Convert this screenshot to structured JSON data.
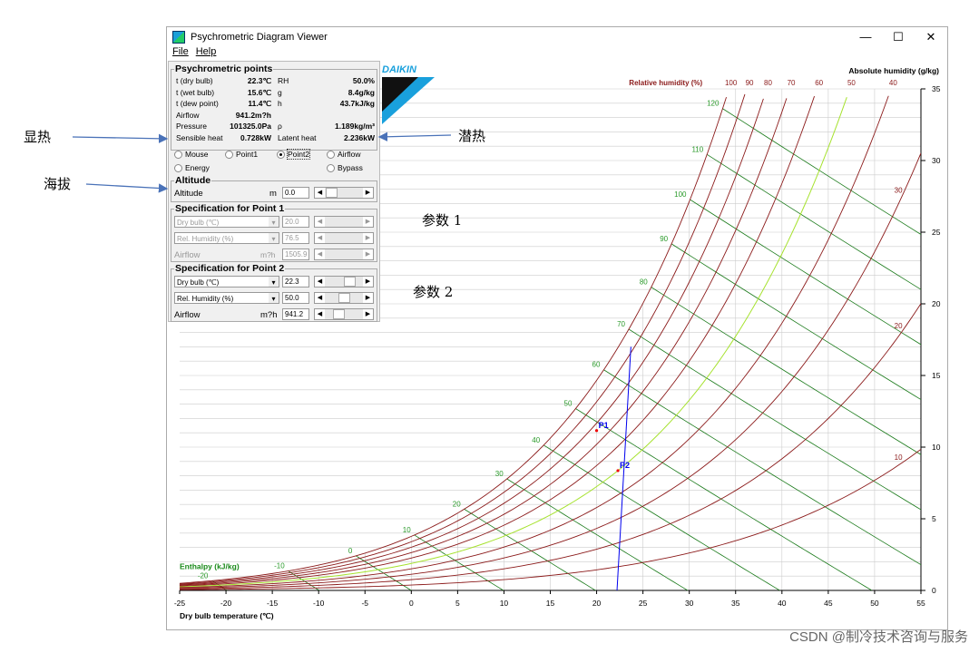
{
  "window": {
    "title": "Psychrometric Diagram Viewer",
    "menu": [
      "File",
      "Help"
    ],
    "controls": [
      "—",
      "☐",
      "✕"
    ]
  },
  "panel": {
    "points_title": "Psychrometric points",
    "rows": [
      {
        "label": "t (dry bulb)",
        "value": "22.3℃",
        "label2": "RH",
        "value2": "50.0%"
      },
      {
        "label": "t (wet bulb)",
        "value": "15.6℃",
        "label2": "g",
        "value2": "8.4g/kg"
      },
      {
        "label": "t (dew point)",
        "value": "11.4℃",
        "label2": "h",
        "value2": "43.7kJ/kg"
      },
      {
        "label": "Airflow",
        "value": "941.2m?h",
        "label2": "",
        "value2": ""
      },
      {
        "label": "Pressure",
        "value": "101325.0Pa",
        "label2": "ρ",
        "value2": "1.189kg/m³"
      },
      {
        "label": "Sensible heat",
        "value": "0.728kW",
        "label2": "Latent heat",
        "value2": "2.236kW"
      }
    ],
    "radios": [
      "Mouse",
      "Point1",
      "Point2",
      "Airflow",
      "Energy",
      "Bypass"
    ],
    "radio_selected": "Point2",
    "altitude": {
      "title": "Altitude",
      "label": "Altitude",
      "unit": "m",
      "value": "0.0"
    },
    "point1": {
      "title": "Specification for Point 1",
      "param1": "Dry bulb (℃)",
      "value1": "20.0",
      "param2": "Rel. Humidity (%)",
      "value2": "76.5",
      "airflow_label": "Airflow",
      "airflow_unit": "m?h",
      "airflow": "1505.9"
    },
    "point2": {
      "title": "Specification for Point 2",
      "param1": "Dry bulb (℃)",
      "value1": "22.3",
      "param2": "Rel. Humidity (%)",
      "value2": "50.0",
      "airflow_label": "Airflow",
      "airflow_unit": "m?h",
      "airflow": "941.2"
    }
  },
  "logo": "DAIKIN",
  "annotations": {
    "sensible": "显热",
    "latent": "潜热",
    "altitude": "海拔",
    "param1": "参数 1",
    "param2": "参数 2"
  },
  "watermark": "CSDN @制冷技术咨询与服务",
  "chart_data": {
    "type": "line",
    "title_right": "Absolute humidity (g/kg)",
    "rh_label": "Relative humidity (%)",
    "enthalpy_label": "Enthalpy (kJ/kg)",
    "xlabel": "Dry bulb temperature (℃)",
    "xlim": [
      -25,
      55
    ],
    "ylim": [
      0,
      35
    ],
    "xticks": [
      -25,
      -20,
      -15,
      -10,
      -5,
      0,
      5,
      10,
      15,
      20,
      25,
      30,
      35,
      40,
      45,
      50,
      55
    ],
    "yticks": [
      0,
      5,
      10,
      15,
      20,
      25,
      30,
      35
    ],
    "rh_curves": [
      100,
      90,
      80,
      70,
      60,
      50,
      40,
      30,
      20,
      10
    ],
    "enthalpy_lines": [
      -20,
      -10,
      0,
      10,
      20,
      30,
      40,
      50,
      60,
      70,
      80,
      90,
      100,
      110,
      120
    ],
    "pressure_pa": 101325,
    "points": [
      {
        "name": "P1",
        "t": 20.0,
        "rh": 76.5
      },
      {
        "name": "P2",
        "t": 22.3,
        "rh": 50.0
      }
    ],
    "colors": {
      "rh": "#8b1a1a",
      "rh50": "#a6e22e",
      "enthalpy": "#1a7a1a",
      "points": "#0000ee",
      "grid": "#cccccc"
    }
  }
}
